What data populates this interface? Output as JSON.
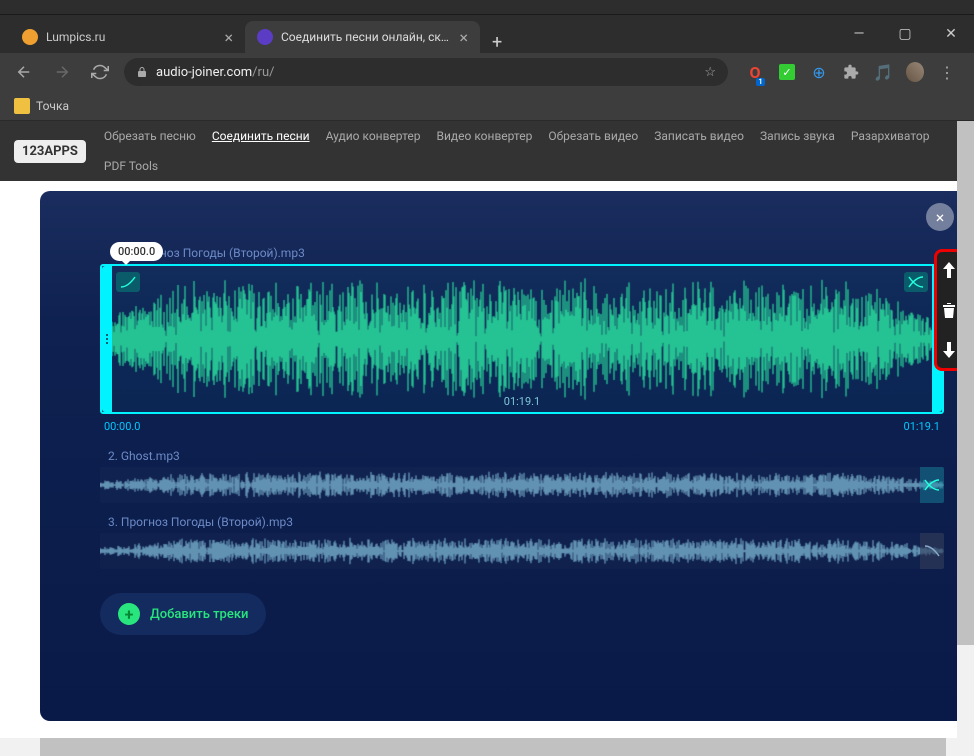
{
  "browser": {
    "tabs": [
      {
        "title": "Lumpics.ru",
        "favicon_color": "#f0a030"
      },
      {
        "title": "Соединить песни онлайн, склеи",
        "favicon_color": "#5b3cc4"
      }
    ],
    "url_domain": "audio-joiner.com",
    "url_path": "/ru/",
    "bookmark": "Точка"
  },
  "site": {
    "logo": "123APPS",
    "nav": [
      "Обрезать песню",
      "Соединить песни",
      "Аудио конвертер",
      "Видео конвертер",
      "Обрезать видео",
      "Записать видео",
      "Запись звука",
      "Разархиватор",
      "PDF Tools"
    ],
    "active_nav": 1
  },
  "editor": {
    "active_track": {
      "title": "огноз Погоды (Второй).mp3",
      "badge_time": "00:00.0",
      "duration": "01:19.1",
      "start_time": "00:00.0",
      "end_time": "01:19.1"
    },
    "tracks": [
      {
        "label": "2. Ghost.mp3"
      },
      {
        "label": "3. Прогноз Погоды (Второй).mp3"
      }
    ],
    "add_button": "Добавить треки"
  }
}
